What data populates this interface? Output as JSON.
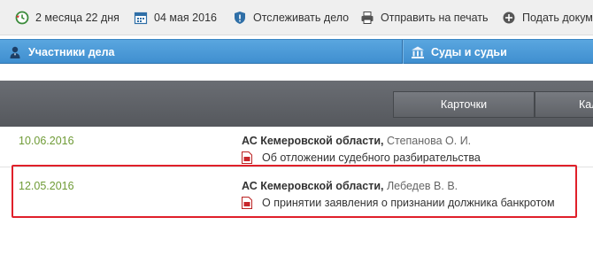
{
  "toolbar": {
    "items": [
      {
        "label": "2 месяца 22 дня",
        "icon": "clock-arrow-icon"
      },
      {
        "label": "04 мая 2016",
        "icon": "calendar-icon"
      },
      {
        "label": "Отслеживать дело",
        "icon": "shield-icon"
      },
      {
        "label": "Отправить на печать",
        "icon": "printer-icon"
      },
      {
        "label": "Подать докумен",
        "icon": "plus-circle-icon"
      }
    ]
  },
  "tabs": [
    {
      "label": "Участники дела",
      "icon": "person-icon"
    },
    {
      "label": "Суды и судьи",
      "icon": "courthouse-icon"
    }
  ],
  "view_buttons": [
    {
      "label": "Карточки"
    },
    {
      "label": "Кал"
    }
  ],
  "rows": [
    {
      "date": "10.06.2016",
      "court": "АС Кемеровской области,",
      "judge": "Степанова О. И.",
      "document": "Об отложении судебного разбирательства"
    },
    {
      "date": "12.05.2016",
      "court": "АС Кемеровской области,",
      "judge": "Лебедев В. В.",
      "document": "О принятии заявления о признании должника банкротом"
    }
  ],
  "colors": {
    "tab_bar": "#4a9ad8",
    "dark_bar": "#5f6267",
    "date_green": "#6f9b36",
    "highlight_red": "#e0202a"
  }
}
